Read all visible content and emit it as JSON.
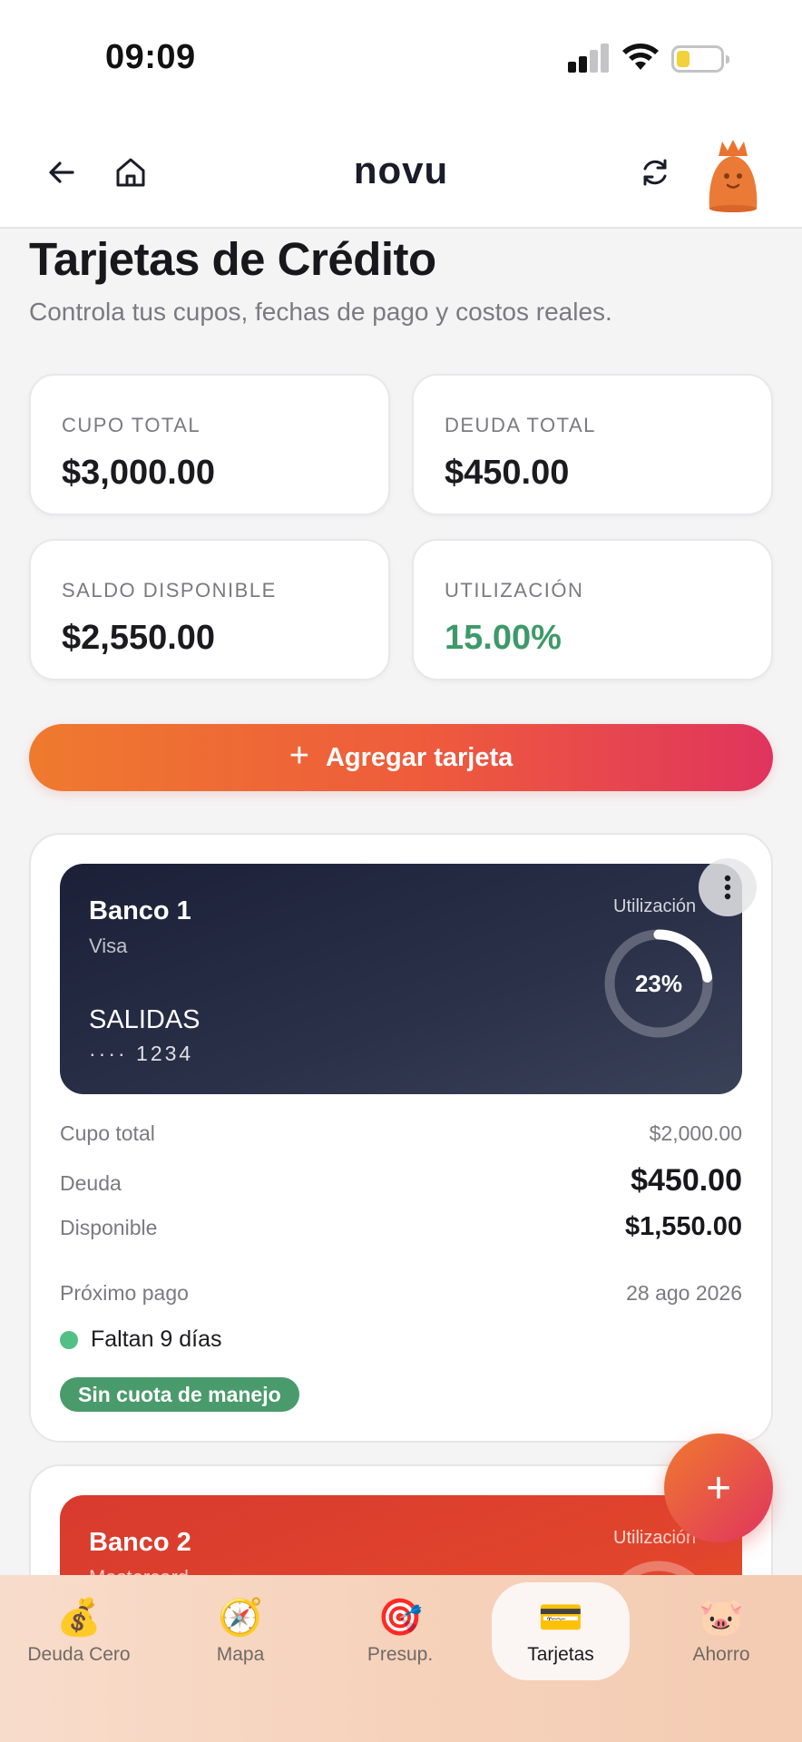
{
  "status_bar": {
    "time": "09:09"
  },
  "header": {
    "logo": "novu"
  },
  "page": {
    "title": "Tarjetas de Crédito",
    "subtitle": "Controla tus cupos, fechas de pago y costos reales."
  },
  "stats": [
    {
      "label": "CUPO TOTAL",
      "value": "$3,000.00"
    },
    {
      "label": "DEUDA TOTAL",
      "value": "$450.00"
    },
    {
      "label": "SALDO DISPONIBLE",
      "value": "$2,550.00"
    },
    {
      "label": "UTILIZACIÓN",
      "value": "15.00%",
      "color": "#3d9a68"
    }
  ],
  "add_button": {
    "label": "Agregar tarjeta"
  },
  "cards": [
    {
      "bank": "Banco 1",
      "network": "Visa",
      "name": "SALIDAS",
      "number": "···· 1234",
      "utilization_label": "Utilización",
      "utilization": "23%",
      "utilization_value": 0.23,
      "rows": [
        {
          "label": "Cupo total",
          "value": "$2,000.00"
        },
        {
          "label": "Deuda",
          "value": "$450.00"
        },
        {
          "label": "Disponible",
          "value": "$1,550.00"
        },
        {
          "label": "Próximo pago",
          "value": "28 ago 2026"
        }
      ],
      "due_text": "Faltan 9 días",
      "badge": "Sin cuota de manejo"
    },
    {
      "bank": "Banco 2",
      "network": "Mastercard",
      "utilization_label": "Utilización"
    }
  ],
  "bottom_nav": [
    {
      "label": "Deuda Cero",
      "icon": "money-bag-icon",
      "glyph": "💰"
    },
    {
      "label": "Mapa",
      "icon": "compass-icon",
      "glyph": "🧭"
    },
    {
      "label": "Presup.",
      "icon": "target-icon",
      "glyph": "🎯"
    },
    {
      "label": "Tarjetas",
      "icon": "credit-card-icon",
      "glyph": "💳",
      "active": true
    },
    {
      "label": "Ahorro",
      "icon": "pig-icon",
      "glyph": "🐷"
    }
  ]
}
